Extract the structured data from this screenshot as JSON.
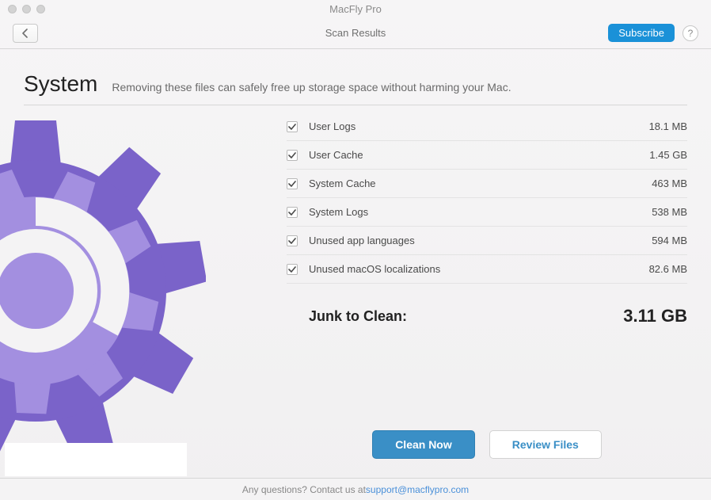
{
  "window": {
    "title": "MacFly Pro",
    "subtitle": "Scan Results"
  },
  "toolbar": {
    "subscribe": "Subscribe",
    "help": "?"
  },
  "section": {
    "title": "System",
    "description": "Removing these files can safely free up storage space without harming your Mac."
  },
  "items": [
    {
      "label": "User Logs",
      "size": "18.1 MB",
      "checked": true
    },
    {
      "label": "User Cache",
      "size": "1.45 GB",
      "checked": true
    },
    {
      "label": "System Cache",
      "size": "463 MB",
      "checked": true
    },
    {
      "label": "System Logs",
      "size": "538 MB",
      "checked": true
    },
    {
      "label": "Unused app languages",
      "size": "594 MB",
      "checked": true
    },
    {
      "label": "Unused macOS localizations",
      "size": "82.6 MB",
      "checked": true
    }
  ],
  "summary": {
    "label": "Junk to Clean:",
    "value": "3.11 GB"
  },
  "actions": {
    "primary": "Clean Now",
    "secondary": "Review Files"
  },
  "footer": {
    "prefix": "Any questions? Contact us at ",
    "email": "support@macflypro.com"
  }
}
